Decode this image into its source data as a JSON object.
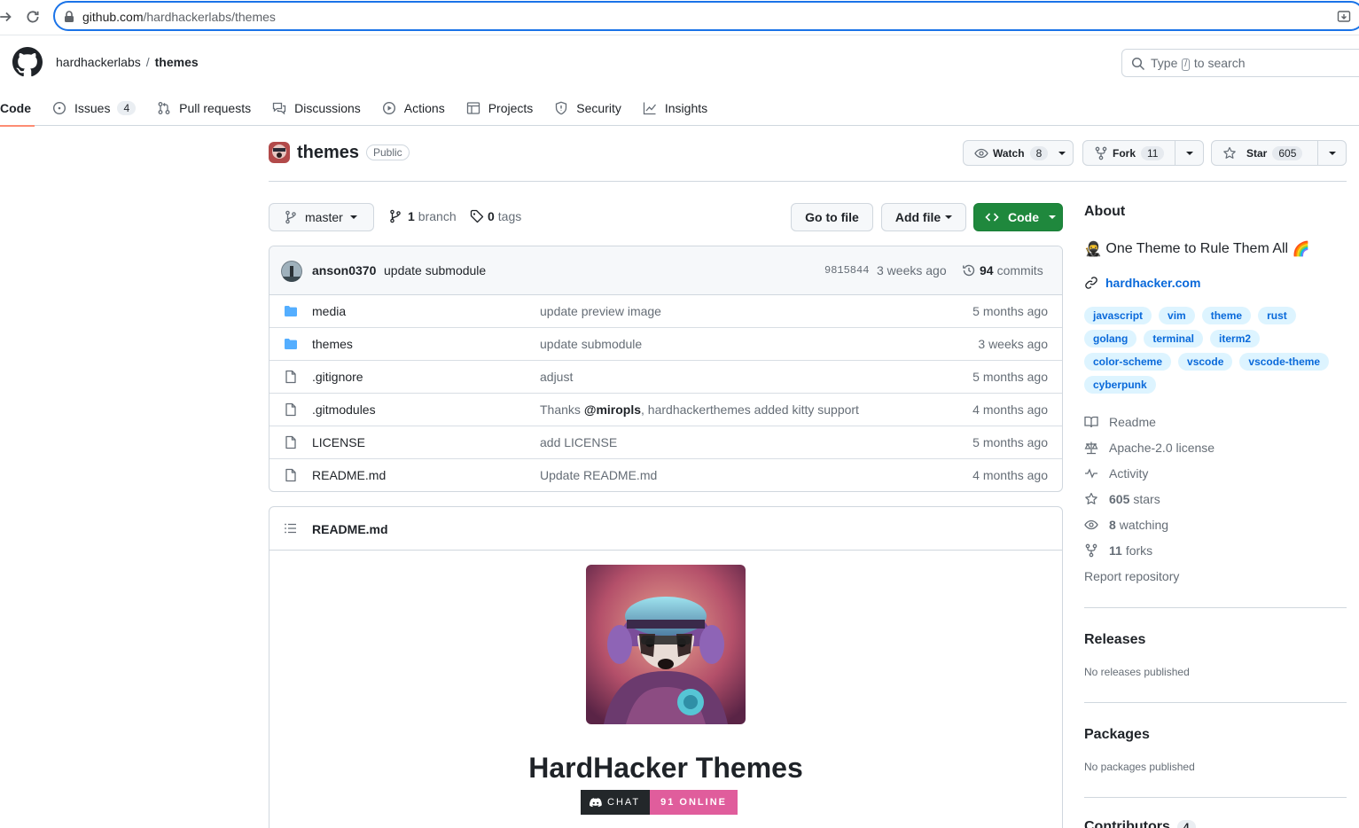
{
  "browser": {
    "url_host": "github.com",
    "url_path": "/hardhackerlabs/themes"
  },
  "header": {
    "owner": "hardhackerlabs",
    "separator": "/",
    "repo": "themes",
    "search_prefix": "Type",
    "search_key": "/",
    "search_suffix": "to search"
  },
  "tabs": [
    {
      "label": "Code",
      "icon": "code-icon"
    },
    {
      "label": "Issues",
      "icon": "issue-icon",
      "count": "4"
    },
    {
      "label": "Pull requests",
      "icon": "pull-request-icon"
    },
    {
      "label": "Discussions",
      "icon": "discussion-icon"
    },
    {
      "label": "Actions",
      "icon": "play-icon"
    },
    {
      "label": "Projects",
      "icon": "table-icon"
    },
    {
      "label": "Security",
      "icon": "shield-icon"
    },
    {
      "label": "Insights",
      "icon": "graph-icon"
    }
  ],
  "repo": {
    "name": "themes",
    "visibility": "Public",
    "watch_label": "Watch",
    "watch_count": "8",
    "fork_label": "Fork",
    "fork_count": "11",
    "star_label": "Star",
    "star_count": "605"
  },
  "branch_bar": {
    "branch": "master",
    "branch_count": "1",
    "branch_word": "branch",
    "tag_count": "0",
    "tag_word": "tags",
    "go_to_file": "Go to file",
    "add_file": "Add file",
    "code": "Code"
  },
  "latest_commit": {
    "author": "anson0370",
    "message": "update submodule",
    "sha": "9815844",
    "time": "3 weeks ago",
    "count": "94",
    "count_word": "commits"
  },
  "files": [
    {
      "name": "media",
      "type": "dir",
      "commit": "update preview image",
      "age": "5 months ago"
    },
    {
      "name": "themes",
      "type": "dir",
      "commit": "update submodule",
      "age": "3 weeks ago"
    },
    {
      "name": ".gitignore",
      "type": "file",
      "commit": "adjust",
      "age": "5 months ago"
    },
    {
      "name": ".gitmodules",
      "type": "file",
      "commit_prefix": "Thanks ",
      "commit_mention": "@miropls",
      "commit_suffix": ", hardhackerthemes added kitty support",
      "age": "4 months ago"
    },
    {
      "name": "LICENSE",
      "type": "file",
      "commit": "add LICENSE",
      "age": "5 months ago"
    },
    {
      "name": "README.md",
      "type": "file",
      "commit": "Update README.md",
      "age": "4 months ago"
    }
  ],
  "readme": {
    "file": "README.md",
    "heading": "HardHacker Themes",
    "badge_left": "CHAT",
    "badge_right": "91 ONLINE"
  },
  "about": {
    "heading": "About",
    "description_emoji_left": "🥷",
    "description": "One Theme to Rule Them All",
    "description_emoji_right": "🌈",
    "website": "hardhacker.com",
    "topics": [
      "javascript",
      "vim",
      "theme",
      "rust",
      "golang",
      "terminal",
      "iterm2",
      "color-scheme",
      "vscode",
      "vscode-theme",
      "cyberpunk"
    ],
    "readme": "Readme",
    "license": "Apache-2.0 license",
    "activity": "Activity",
    "stars_count": "605",
    "stars_word": "stars",
    "watching_count": "8",
    "watching_word": "watching",
    "forks_count": "11",
    "forks_word": "forks",
    "report": "Report repository"
  },
  "releases": {
    "heading": "Releases",
    "text": "No releases published"
  },
  "packages": {
    "heading": "Packages",
    "text": "No packages published"
  },
  "contributors": {
    "heading": "Contributors",
    "count": "4"
  },
  "colors": {
    "accent_green": "#1f883d",
    "link_blue": "#0969da",
    "tab_underline": "#fd8c73",
    "topic_bg": "#ddf4ff",
    "badge_pink": "#e05d9c"
  }
}
